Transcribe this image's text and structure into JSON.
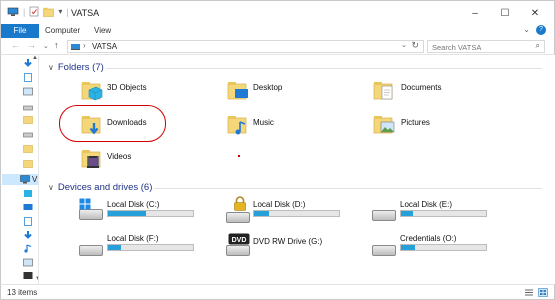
{
  "window": {
    "title": "VATSA",
    "controls": [
      "–",
      "☐",
      "✕"
    ]
  },
  "ribbon": {
    "tabs": [
      {
        "label": "File"
      },
      {
        "label": "Computer"
      },
      {
        "label": "View"
      }
    ],
    "collapse_glyph": "⌄",
    "help_glyph": "?"
  },
  "address_bar": {
    "path": "VATSA",
    "search_placeholder": "Search VATSA"
  },
  "sidebar": {
    "selected_label": "V"
  },
  "groups": {
    "folders": {
      "title": "Folders (7)",
      "items": [
        {
          "name": "3D Objects",
          "icon": "3d-objects-icon"
        },
        {
          "name": "Desktop",
          "icon": "desktop-folder-icon"
        },
        {
          "name": "Documents",
          "icon": "documents-folder-icon"
        },
        {
          "name": "Downloads",
          "icon": "downloads-folder-icon"
        },
        {
          "name": "Music",
          "icon": "music-folder-icon"
        },
        {
          "name": "Pictures",
          "icon": "pictures-folder-icon"
        },
        {
          "name": "Videos",
          "icon": "videos-folder-icon"
        }
      ]
    },
    "drives": {
      "title": "Devices and drives (6)",
      "items": [
        {
          "name": "Local Disk (C:)",
          "icon": "windows-drive-icon",
          "used_fraction": 0.45
        },
        {
          "name": "Local Disk (D:)",
          "icon": "locked-drive-icon",
          "used_fraction": 0.18
        },
        {
          "name": "Local Disk (E:)",
          "icon": "hard-drive-icon",
          "used_fraction": 0.14
        },
        {
          "name": "Local Disk (F:)",
          "icon": "hard-drive-icon",
          "used_fraction": 0.15
        },
        {
          "name": "DVD RW Drive (G:)",
          "icon": "dvd-drive-icon",
          "used_fraction": null
        },
        {
          "name": "Credentials (O:)",
          "icon": "hard-drive-icon",
          "used_fraction": 0.16
        }
      ]
    }
  },
  "status_bar": {
    "item_count": "13 items"
  },
  "colors": {
    "accent": "#1979ca",
    "highlight_ring": "#d40000",
    "drive_fill": "#26a0da",
    "group_header": "#1e3287"
  }
}
